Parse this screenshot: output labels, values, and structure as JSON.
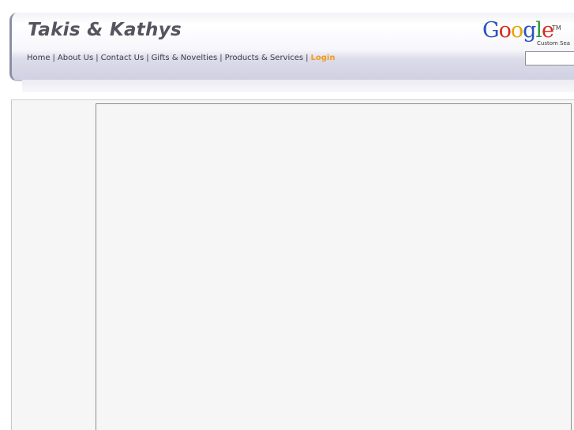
{
  "header": {
    "site_title": "Takis & Kathys"
  },
  "nav": {
    "items": [
      {
        "label": "Home"
      },
      {
        "label": "About Us"
      },
      {
        "label": "Contact Us"
      },
      {
        "label": "Gifts & Novelties"
      },
      {
        "label": "Products & Services"
      }
    ],
    "login_label": "Login",
    "separator": "|"
  },
  "search": {
    "logo_letters": [
      "G",
      "o",
      "o",
      "g",
      "l",
      "e"
    ],
    "trademark": "TM",
    "caption": "Custom Sea",
    "value": ""
  },
  "colors": {
    "login": "#f39a1c",
    "title": "#55555f"
  }
}
